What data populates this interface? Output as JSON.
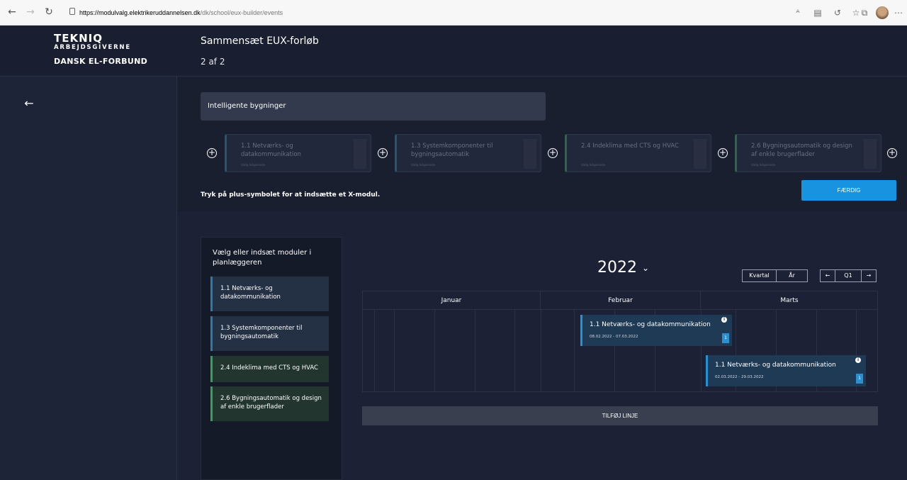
{
  "browser": {
    "url_host": "https://modulvalg.elektrikeruddannelsen.dk",
    "url_path": "/dk/school/eux-builder/events"
  },
  "logo": {
    "line1": "TEKNIQ",
    "line2": "ARBEJDSGIVERNE",
    "line3": "DANSK EL-FORBUND"
  },
  "header": {
    "title": "Sammensæt EUX-forløb",
    "step": "2 af 2"
  },
  "program": {
    "name": "Intelligente bygninger",
    "modules": [
      {
        "title": "1.1 Netværks- og datakommunikation",
        "sub": "Vælg tidsperiode"
      },
      {
        "title": "1.3 Systemkomponenter til bygningsautomatik",
        "sub": "Vælg tidsperiode"
      },
      {
        "title": "2.4 Indeklima med CTS og HVAC",
        "sub": "Vælg tidsperiode"
      },
      {
        "title": "2.6 Bygningsautomatik og design af enkle brugerflader",
        "sub": "Vælg tidsperiode"
      }
    ],
    "hint": "Tryk på plus-symbolet for at indsætte et X-modul.",
    "done_label": "FÆRDIG"
  },
  "picker": {
    "title": "Vælg eller indsæt moduler i planlæggeren",
    "items": [
      {
        "label": "1.1 Netværks- og datakommunikation"
      },
      {
        "label": "1.3 Systemkomponenter til bygningsautomatik"
      },
      {
        "label": "2.4 Indeklima med CTS og HVAC"
      },
      {
        "label": "2.6 Bygningsautomatik og design af enkle brugerflader"
      }
    ]
  },
  "planner": {
    "year": "2022",
    "view_quarter": "Kvartal",
    "view_year": "År",
    "period": "Q1",
    "months": [
      "Januar",
      "Februar",
      "Marts"
    ],
    "events": [
      {
        "title": "1.1 Netværks- og datakommunikation",
        "dates": "08.02.2022 - 07.03.2022",
        "count": "1"
      },
      {
        "title": "1.1 Netværks- og datakommunikation",
        "dates": "02.03.2022 - 29.03.2022",
        "count": "1"
      }
    ],
    "add_row_label": "TILFØJ LINJE"
  }
}
